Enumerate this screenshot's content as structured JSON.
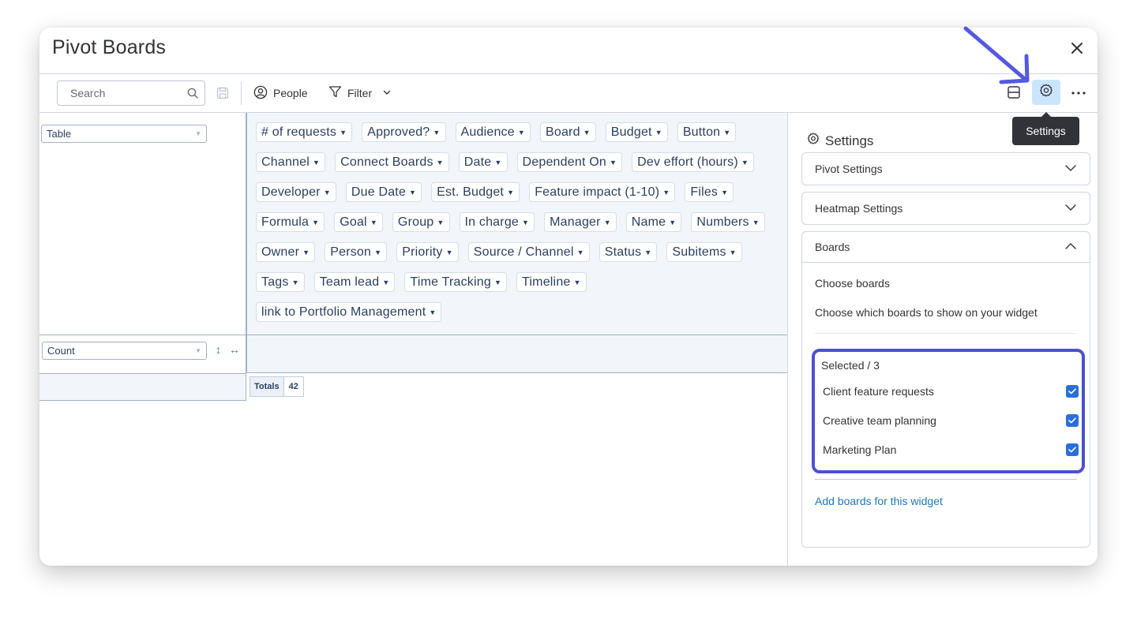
{
  "window": {
    "title": "Pivot Boards"
  },
  "toolbar": {
    "search_placeholder": "Search",
    "people_label": "People",
    "filter_label": "Filter",
    "tooltip": "Settings"
  },
  "pivot": {
    "renderer": "Table",
    "aggregator": "Count",
    "attributes": [
      "# of requests",
      "Approved?",
      "Audience",
      "Board",
      "Budget",
      "Button",
      "Channel",
      "Connect Boards",
      "Date",
      "Dependent On",
      "Dev effort (hours)",
      "Developer",
      "Due Date",
      "Est. Budget",
      "Feature impact (1-10)",
      "Files",
      "Formula",
      "Goal",
      "Group",
      "In charge",
      "Manager",
      "Name",
      "Numbers",
      "Owner",
      "Person",
      "Priority",
      "Source / Channel",
      "Status",
      "Subitems",
      "Tags",
      "Team lead",
      "Time Tracking",
      "Timeline",
      "link to Portfolio Management"
    ],
    "totals_label": "Totals",
    "totals_value": "42"
  },
  "settings": {
    "title": "Settings",
    "sections": {
      "pivot": "Pivot Settings",
      "heatmap": "Heatmap Settings",
      "boards": "Boards"
    },
    "choose_title": "Choose boards",
    "choose_sub": "Choose which boards to show on your widget",
    "selected_label": "Selected / 3",
    "boards": [
      {
        "name": "Client feature requests",
        "checked": true
      },
      {
        "name": "Creative team planning",
        "checked": true
      },
      {
        "name": "Marketing Plan",
        "checked": true
      }
    ],
    "add_link": "Add boards for this widget"
  },
  "colors": {
    "annotation": "#5559df",
    "checkbox": "#2a6fd9",
    "link": "#1f76c2",
    "gear_bg": "#cce5ff"
  }
}
